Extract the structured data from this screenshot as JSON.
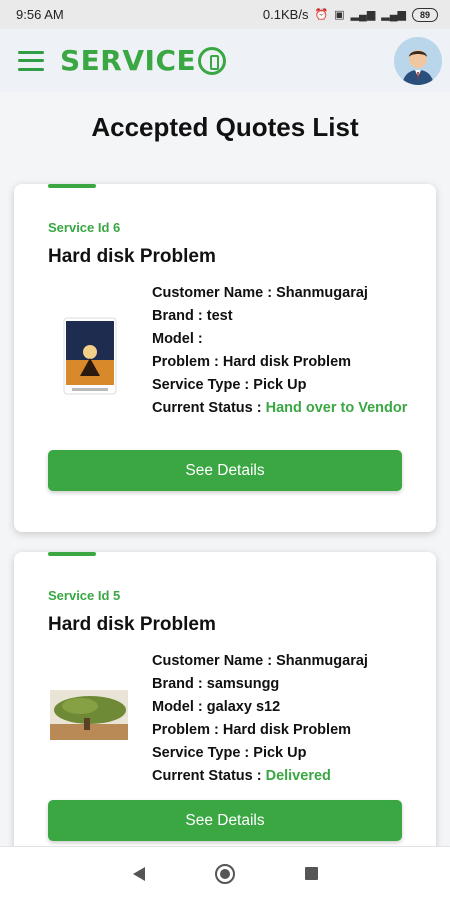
{
  "status_bar": {
    "time": "9:56 AM",
    "network_speed": "0.1KB/s",
    "battery": "89",
    "icons": [
      "alarm-icon",
      "data-icon",
      "signal-icon",
      "signal-icon",
      "battery-icon"
    ]
  },
  "app_bar": {
    "logo_text": "SERVICE",
    "menu_icon": "hamburger-menu-icon",
    "avatar_icon": "user-avatar"
  },
  "page": {
    "title": "Accepted Quotes List"
  },
  "quotes": [
    {
      "service_id": "Service Id 6",
      "title": "Hard disk Problem",
      "customer_name": "Customer Name : Shanmugaraj",
      "brand": "Brand : test",
      "model": "Model :",
      "problem": "Problem : Hard disk Problem",
      "service_type": "Service Type : Pick Up",
      "status_label": "Current Status : ",
      "status_value": "Hand over to Vendor",
      "button_label": "See Details"
    },
    {
      "service_id": "Service Id 5",
      "title": "Hard disk Problem",
      "customer_name": "Customer Name : Shanmugaraj",
      "brand": "Brand : samsungg",
      "model": "Model : galaxy s12",
      "problem": "Problem : Hard disk Problem",
      "service_type": "Service Type : Pick Up",
      "status_label": "Current Status : ",
      "status_value": "Delivered",
      "button_label": "See Details"
    }
  ],
  "colors": {
    "accent": "#3aa743",
    "background": "#f4f5f7",
    "card": "#ffffff"
  }
}
